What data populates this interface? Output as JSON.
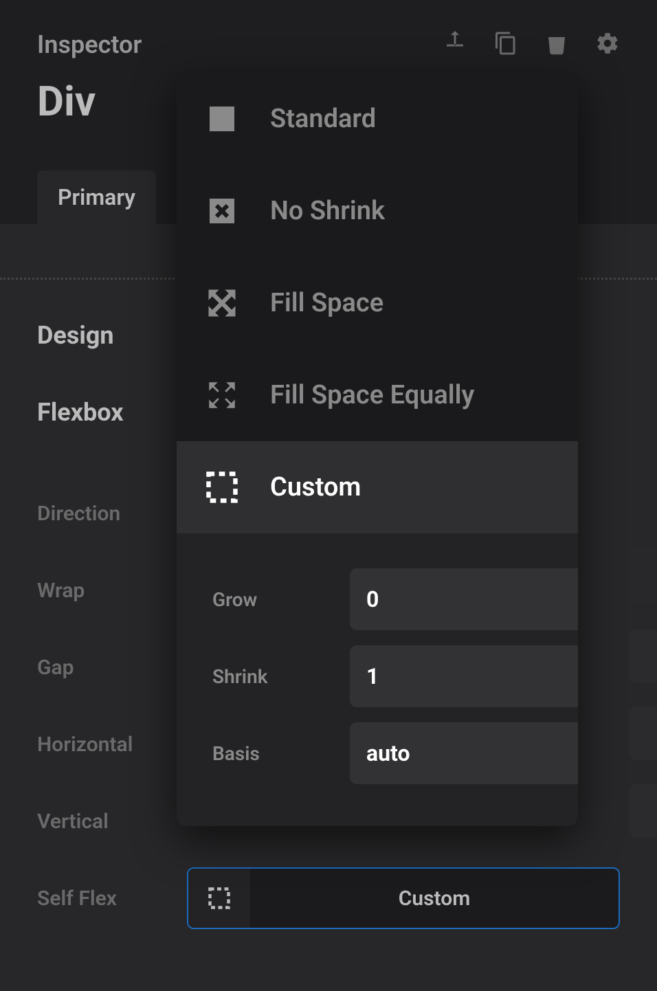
{
  "header": {
    "title": "Inspector",
    "element": "Div"
  },
  "tabs": {
    "primary": "Primary"
  },
  "design": {
    "title": "Design"
  },
  "flexbox": {
    "title": "Flexbox",
    "direction": "Direction",
    "wrap": "Wrap",
    "gap": "Gap",
    "horizontal": "Horizontal",
    "vertical": "Vertical",
    "self_flex": "Self Flex",
    "self_flex_value": "Custom"
  },
  "popup": {
    "standard": "Standard",
    "no_shrink": "No Shrink",
    "fill_space": "Fill Space",
    "fill_space_equally": "Fill Space Equally",
    "custom": "Custom",
    "grow_label": "Grow",
    "grow_value": "0",
    "shrink_label": "Shrink",
    "shrink_value": "1",
    "basis_label": "Basis",
    "basis_value": "auto"
  }
}
